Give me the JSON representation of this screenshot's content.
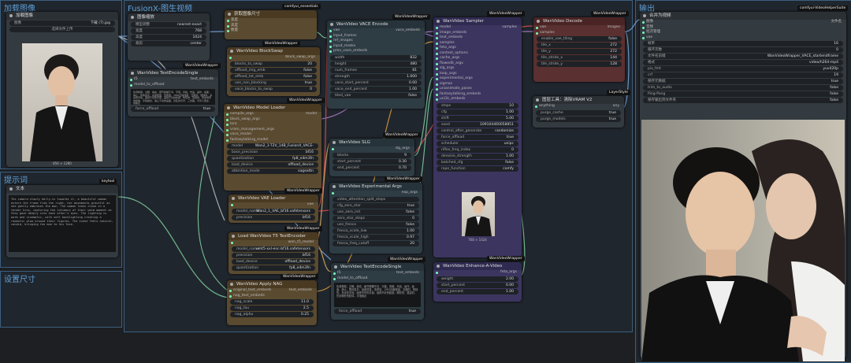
{
  "groups": {
    "load_image": "加载图像",
    "prompt": "提示词",
    "settings": "设置尺寸",
    "fusionx": "FusionX-图生视频",
    "output": "输出"
  },
  "badges": {
    "essentials": "comfyui_essentials",
    "wrapper": "WanVideoWrapper",
    "keytool": "keytool",
    "layerstyle": "LayerStyle",
    "helpersuite": "comfyui-VideoHelperSuite"
  },
  "load_node": {
    "title": "加载图像",
    "image_label": "图像",
    "image_value": "下载 (7).jpg",
    "upload": "选择文件上传",
    "caption": "856 × 1280"
  },
  "prompt_node": {
    "title": "文本",
    "text": "The camera slowly dolly-in towards it, a beautiful woman enters the frame from the right, her movements graceful as she gently embraces the man. The woman leans close in a tender kiss, capturing the intimacy of their warm moment as they gaze deeply into each other's eyes. The lighting is warm and cinematic, with soft backlighting creating a romantic glow around their figures. The scene feels natural, candid, bringing the man to his face."
  },
  "resize_node": {
    "title": "图像缩放",
    "rows": [
      {
        "label": "模型调整",
        "value": "nearest-exact"
      },
      {
        "label": "宽度",
        "value": "768"
      },
      {
        "label": "高度",
        "value": "1024"
      },
      {
        "label": "裁剪",
        "value": "center"
      }
    ]
  },
  "getsize_node": {
    "title": "获取图像尺寸",
    "out1": "宽度",
    "out2": "高度",
    "out3": "数量"
  },
  "blockswap_node": {
    "title": "WanVideo BlockSwap",
    "out": "block_swap_args",
    "rows": [
      {
        "label": "blocks_to_swap",
        "value": "20"
      },
      {
        "label": "offload_img_emb",
        "value": "false"
      },
      {
        "label": "offload_txt_emb",
        "value": "false"
      },
      {
        "label": "use_non_blocking",
        "value": "true"
      },
      {
        "label": "vace_blocks_to_swap",
        "value": "0"
      }
    ]
  },
  "textenc_single_left": {
    "title": "WanVideo TextEncodeSingle",
    "in1": "t5",
    "in2": "model_to_offload",
    "out": "text_embeds",
    "text": "色调艳丽，过曝，静态，细节模糊不清，字幕，风格，作品，画作，画面，静止，整体发灰，最差质量，低质量，JPEG压缩残留，丑陋的，残缺的，多余的手指，画得不好的手部，画得不好的脸部，畸形的，毁容的，形态畸形的肢体，手指融合，静止不动的画面，杂乱的背景，三条腿，背景人很多，倒着走",
    "force_offload": "force_offload",
    "force_value": "true"
  },
  "model_loader": {
    "title": "WanVideo Model Loader",
    "inputs": [
      "compile_args",
      "block_swap_args",
      "lora",
      "vram_management_args",
      "vace_model",
      "fantasytalking_model"
    ],
    "out": "model",
    "rows": [
      {
        "label": "model",
        "value": "Wan2_1-T2V_14B_FusionX_VACE-"
      },
      {
        "label": "base_precision",
        "value": "bf16"
      },
      {
        "label": "quantization",
        "value": "fp8_e4m3fn"
      },
      {
        "label": "load_device",
        "value": "offload_device"
      },
      {
        "label": "attention_mode",
        "value": "sageattn"
      }
    ]
  },
  "vae_loader": {
    "title": "WanVideo VAE Loader",
    "out": "vae",
    "rows": [
      {
        "label": "model_name",
        "value": "Wan2_1_VAE_bf16.safetensors"
      },
      {
        "label": "precision",
        "value": "bf16"
      }
    ]
  },
  "t5_loader": {
    "title": "Load WanVideo T5 TextEncoder",
    "out": "wan_t5_model",
    "rows": [
      {
        "label": "model_name",
        "value": "umt5-xxl-enc-bf16.safetensors"
      },
      {
        "label": "precision",
        "value": "bf16"
      },
      {
        "label": "load_device",
        "value": "offload_device"
      },
      {
        "label": "quantization",
        "value": "fp8_e4m3fn"
      }
    ]
  },
  "nag_node": {
    "title": "WanVideo Apply NAG",
    "in1": "original_text_embeds",
    "in2": "nag_text_embeds",
    "out": "text_embeds",
    "rows": [
      {
        "label": "nag_scale",
        "value": "11.0"
      },
      {
        "label": "nag_tau",
        "value": "2.5"
      },
      {
        "label": "nag_alpha",
        "value": "0.25"
      }
    ]
  },
  "vace_node": {
    "title": "WanVideo VACE Encode",
    "inputs": [
      "vae",
      "input_frames",
      "ref_images",
      "input_masks",
      "prev_vace_embeds"
    ],
    "out": "vace_embeds",
    "rows": [
      {
        "label": "width",
        "value": "832"
      },
      {
        "label": "height",
        "value": "480"
      },
      {
        "label": "num_frames",
        "value": "81"
      },
      {
        "label": "strength",
        "value": "1.000"
      },
      {
        "label": "vace_start_percent",
        "value": "0.00"
      },
      {
        "label": "vace_end_percent",
        "value": "1.00"
      },
      {
        "label": "tiled_vae",
        "value": "false"
      }
    ]
  },
  "slg_node": {
    "title": "WanVideo SLG",
    "out": "slg_args",
    "rows": [
      {
        "label": "blocks",
        "value": "9"
      },
      {
        "label": "start_percent",
        "value": "0.30"
      },
      {
        "label": "end_percent",
        "value": "0.70"
      }
    ]
  },
  "exp_node": {
    "title": "WanVideo Experimental Args",
    "out": "exp_args",
    "rows": [
      {
        "label": "video_attention_split_steps",
        "value": ""
      },
      {
        "label": "cfg_zero_star",
        "value": "true"
      },
      {
        "label": "use_zero_init",
        "value": "false"
      },
      {
        "label": "zero_star_steps",
        "value": "0"
      },
      {
        "label": "use_fresca",
        "value": "false"
      },
      {
        "label": "fresca_scale_low",
        "value": "1.00"
      },
      {
        "label": "fresca_scale_high",
        "value": "0.97"
      },
      {
        "label": "fresca_freq_cutoff",
        "value": "20"
      }
    ]
  },
  "textenc_single_mid": {
    "title": "WanVideo TextEncodeSingle",
    "in1": "t5",
    "in2": "model_to_offload",
    "out": "text_embeds",
    "text": "色调艳丽，过曝，静态，细节模糊不清，字幕，风格，作品，画作，画面，静止，整体发灰，最差质量，低质量，JPEG压缩残留，丑陋的，残缺的，多余的手指，画得不好的手部，画得不好的脸部，畸形的，毁容的，形态畸形的肢体，手指融合",
    "force_offload": "force_offload",
    "force_value": "true"
  },
  "sampler_node": {
    "title": "WanVideo Sampler",
    "inputs": [
      "model",
      "image_embeds",
      "text_embeds",
      "samples",
      "feta_args",
      "context_options",
      "cache_args",
      "flowedit_args",
      "slg_args",
      "loop_args",
      "experimental_args",
      "sigmas",
      "unianimate_poses",
      "fantasytalking_embeds",
      "uni3c_embeds"
    ],
    "out": "samples",
    "rows": [
      {
        "label": "steps",
        "value": "10"
      },
      {
        "label": "cfg",
        "value": "1.00"
      },
      {
        "label": "shift",
        "value": "5.00"
      },
      {
        "label": "seed",
        "value": "109104460058851"
      },
      {
        "label": "control_after_generate",
        "value": "randomize"
      },
      {
        "label": "force_offload",
        "value": "true"
      },
      {
        "label": "scheduler",
        "value": "unipc"
      },
      {
        "label": "riflex_freq_index",
        "value": "0"
      },
      {
        "label": "denoise_strength",
        "value": "1.00"
      },
      {
        "label": "batched_cfg",
        "value": "false"
      },
      {
        "label": "rope_function",
        "value": "comfy"
      }
    ],
    "caption": "768 × 1024"
  },
  "enhance_node": {
    "title": "WanVideo Enhance-A-Video",
    "out": "feta_args",
    "rows": [
      {
        "label": "weight",
        "value": "2.00"
      },
      {
        "label": "start_percent",
        "value": "0.00"
      },
      {
        "label": "end_percent",
        "value": "1.00"
      }
    ]
  },
  "decode_node": {
    "title": "WanVideo Decode",
    "in1": "vae",
    "in2": "samples",
    "out": "images",
    "rows": [
      {
        "label": "enable_vae_tiling",
        "value": "false"
      },
      {
        "label": "tile_x",
        "value": "272"
      },
      {
        "label": "tile_y",
        "value": "272"
      },
      {
        "label": "tile_stride_x",
        "value": "144"
      },
      {
        "label": "tile_stride_y",
        "value": "128"
      }
    ]
  },
  "vram_node": {
    "title": "图层工具：清除VRAM V2",
    "in1": "anything",
    "out": "any",
    "rows": [
      {
        "label": "purge_cache",
        "value": "true"
      },
      {
        "label": "purge_models",
        "value": "true"
      }
    ]
  },
  "combine_node": {
    "title": "合并为视频",
    "inputs": [
      "图像",
      "音频",
      "批次管理",
      "vae"
    ],
    "out": "文件名",
    "rows": [
      {
        "label": "帧率",
        "value": "16"
      },
      {
        "label": "循环次数",
        "value": "0"
      },
      {
        "label": "文件名前缀",
        "value": "WanVideoWrapper_VACE_startendframe"
      },
      {
        "label": "格式",
        "value": "video/h264-mp4"
      },
      {
        "label": "pix_fmt",
        "value": "yuv420p"
      },
      {
        "label": "crf",
        "value": "19"
      },
      {
        "label": "保存元数据",
        "value": "true"
      },
      {
        "label": "trim_to_audio",
        "value": "false"
      },
      {
        "label": "Ping-Pong",
        "value": "false"
      },
      {
        "label": "保存输出到文件夹",
        "value": "false"
      }
    ]
  },
  "colors": {
    "canvas": "#1d1f22",
    "group_border": "#3b5f80",
    "wire_green": "#7fd0a0",
    "wire_blue": "#78a8e0",
    "wire_purple": "#b080d0"
  }
}
